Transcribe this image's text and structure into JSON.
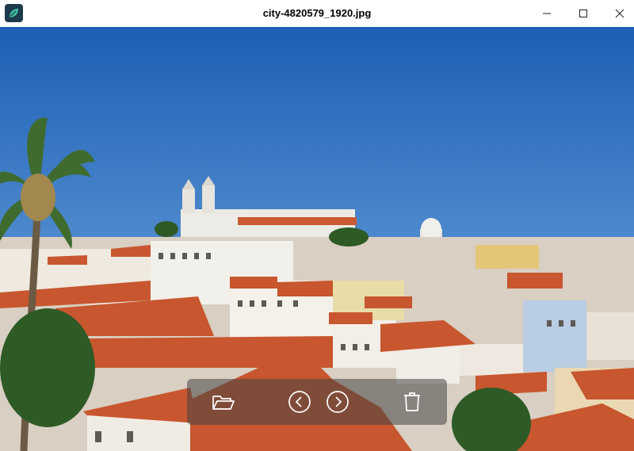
{
  "window": {
    "title": "city-4820579_1920.jpg",
    "app_icon": "leaf-app-icon",
    "controls": [
      "minimize-icon",
      "maximize-icon",
      "close-icon"
    ]
  },
  "viewer": {
    "image_description_icon": "photo",
    "toolbar": {
      "buttons": [
        "folder-open-icon",
        "chevron-left-icon",
        "chevron-right-icon",
        "trash-icon"
      ]
    }
  },
  "colors": {
    "sky_top": "#1c5fb5",
    "sky_bottom": "#6aa6dc",
    "roof": "#c8562e",
    "toolbar_bg": "#464646"
  }
}
